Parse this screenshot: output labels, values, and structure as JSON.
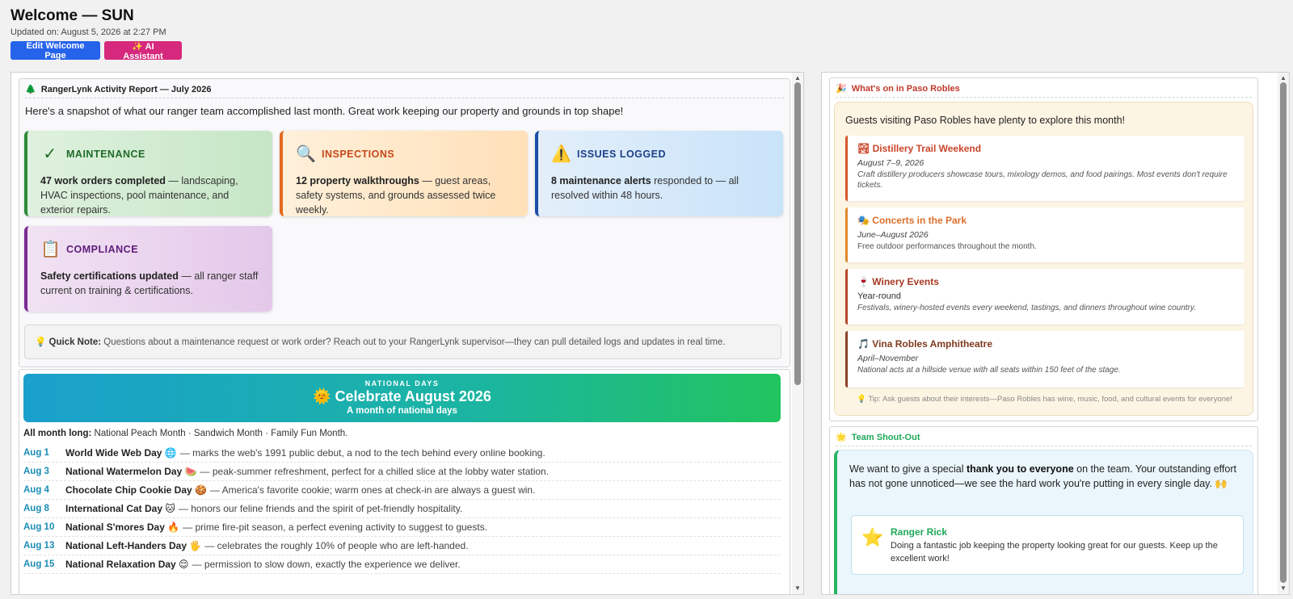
{
  "header": {
    "title": "Welcome — SUN",
    "updated": "Updated on: August 5, 2026 at 2:27 PM",
    "edit_button": "Edit Welcome Page",
    "ai_button": "✨ AI Assistant"
  },
  "report": {
    "icon": "🌲",
    "title": "RangerLynk Activity Report — July 2026",
    "intro": "Here's a snapshot of what our ranger team accomplished last month. Great work keeping our property and grounds in top shape!",
    "stats": [
      {
        "icon": "✓",
        "heading": "MAINTENANCE",
        "bold": "47 work orders completed",
        "rest": " — landscaping, HVAC inspections, pool maintenance, and exterior repairs."
      },
      {
        "icon": "🔍",
        "heading": "INSPECTIONS",
        "bold": "12 property walkthroughs",
        "rest": " — guest areas, safety systems, and grounds assessed twice weekly."
      },
      {
        "icon": "⚠️",
        "heading": "ISSUES LOGGED",
        "bold": "8 maintenance alerts",
        "rest": " responded to — all resolved within 48 hours."
      },
      {
        "icon": "📋",
        "heading": "COMPLIANCE",
        "bold": "Safety certifications updated",
        "rest": " — all ranger staff current on training & certifications."
      }
    ],
    "quick_note_icon": "💡",
    "quick_note_label": "Quick Note:",
    "quick_note_text": " Questions about a maintenance request or work order? Reach out to your RangerLynk supervisor—they can pull detailed logs and updates in real time."
  },
  "national_days": {
    "eyebrow": "NATIONAL DAYS",
    "title": "🌞 Celebrate August 2026",
    "subtitle": "A month of national days",
    "all_month_label": "All month long:",
    "all_month_text": " National Peach Month · Sandwich Month · Family Fun Month.",
    "days": [
      {
        "date": "Aug 1",
        "name": "World Wide Web Day 🌐",
        "desc": "— marks the web's 1991 public debut, a nod to the tech behind every online booking."
      },
      {
        "date": "Aug 3",
        "name": "National Watermelon Day 🍉",
        "desc": "— peak-summer refreshment, perfect for a chilled slice at the lobby water station."
      },
      {
        "date": "Aug 4",
        "name": "Chocolate Chip Cookie Day 🍪",
        "desc": "— America's favorite cookie; warm ones at check-in are always a guest win."
      },
      {
        "date": "Aug 8",
        "name": "International Cat Day 🐱",
        "desc": "— honors our feline friends and the spirit of pet-friendly hospitality."
      },
      {
        "date": "Aug 10",
        "name": "National S'mores Day 🔥",
        "desc": "— prime fire-pit season, a perfect evening activity to suggest to guests."
      },
      {
        "date": "Aug 13",
        "name": "National Left-Handers Day 🖐",
        "desc": "— celebrates the roughly 10% of people who are left-handed."
      },
      {
        "date": "Aug 15",
        "name": "National Relaxation Day 😌",
        "desc": "— permission to slow down, exactly the experience we deliver."
      }
    ]
  },
  "whats_on": {
    "icon": "🎉",
    "title": "What's on in Paso Robles",
    "intro": "Guests visiting Paso Robles have plenty to explore this month!",
    "events": [
      {
        "icon": "🏞",
        "title": "Distillery Trail Weekend",
        "when": "August 7–9, 2026",
        "desc": "Craft distillery producers showcase tours, mixology demos, and food pairings. Most events don't require tickets."
      },
      {
        "icon": "🎭",
        "title": "Concerts in the Park",
        "when": "June–August 2026",
        "desc": "Free outdoor performances throughout the month."
      },
      {
        "icon": "🍷",
        "title": "Winery Events",
        "when": "Year-round",
        "desc": "Festivals, winery-hosted events every weekend, tastings, and dinners throughout wine country."
      },
      {
        "icon": "🎵",
        "title": "Vina Robles Amphitheatre",
        "when": "April–November",
        "desc": "National acts at a hillside venue with all seats within 150 feet of the stage."
      }
    ],
    "tip": "💡 Tip: Ask guests about their interests—Paso Robles has wine, music, food, and cultural events for everyone!"
  },
  "shout_out": {
    "icon": "🌟",
    "title": "Team Shout-Out",
    "text_a": "We want to give a special ",
    "text_bold": "thank you to everyone",
    "text_b": " on the team. Your outstanding effort has not gone unnoticed—we see the hard work you're putting in every single day. 🙌",
    "ranger_icon": "⭐",
    "ranger_name": "Ranger Rick",
    "ranger_desc": "Doing a fantastic job keeping the property looking great for our guests. Keep up the excellent work!"
  }
}
